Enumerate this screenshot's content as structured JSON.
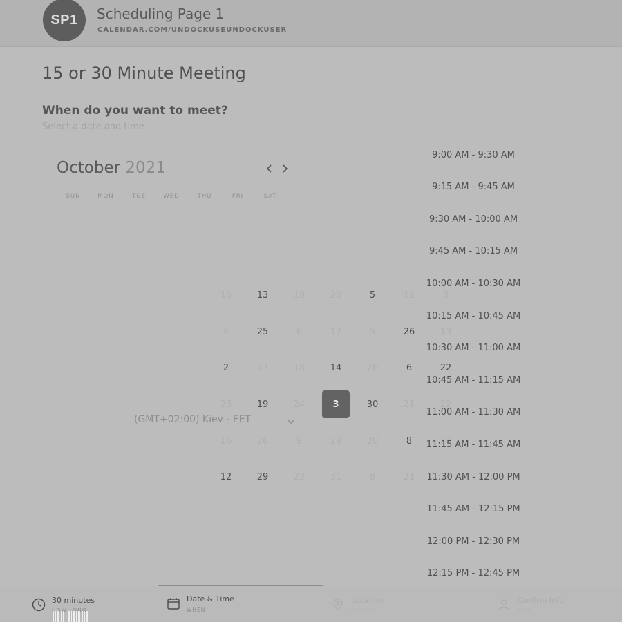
{
  "header": {
    "avatar_initials": "SP1",
    "page_name": "Scheduling Page 1",
    "page_url": "CALENDAR.COM/UNDOCKUSEUNDOCKUSER"
  },
  "meeting": {
    "title": "15 or 30 Minute Meeting",
    "question": "When do you want to meet?",
    "subtitle": "Select a date and time"
  },
  "calendar": {
    "month": "October",
    "year": "2021",
    "prev_icon": "chevron-left-icon",
    "next_icon": "chevron-right-icon",
    "weekdays": [
      "SUN",
      "MON",
      "TUE",
      "WED",
      "THU",
      "FRI",
      "SAT"
    ],
    "selected_day": "3",
    "days": [
      {
        "label": "16",
        "state": "faded"
      },
      {
        "label": "13",
        "state": "available"
      },
      {
        "label": "19",
        "state": "faded"
      },
      {
        "label": "20",
        "state": "faded"
      },
      {
        "label": "5",
        "state": "available"
      },
      {
        "label": "12",
        "state": "faded"
      },
      {
        "label": "8",
        "state": "faded"
      },
      {
        "label": "4",
        "state": "faded"
      },
      {
        "label": "25",
        "state": "available"
      },
      {
        "label": "6",
        "state": "faded"
      },
      {
        "label": "17",
        "state": "faded"
      },
      {
        "label": "5",
        "state": "faded"
      },
      {
        "label": "26",
        "state": "available"
      },
      {
        "label": "13",
        "state": "faded"
      },
      {
        "label": "2",
        "state": "available"
      },
      {
        "label": "27",
        "state": "faded"
      },
      {
        "label": "18",
        "state": "faded"
      },
      {
        "label": "14",
        "state": "available"
      },
      {
        "label": "26",
        "state": "faded"
      },
      {
        "label": "6",
        "state": "available"
      },
      {
        "label": "22",
        "state": "available"
      },
      {
        "label": "23",
        "state": "faded"
      },
      {
        "label": "19",
        "state": "available"
      },
      {
        "label": "24",
        "state": "faded"
      },
      {
        "label": "3",
        "state": "selected"
      },
      {
        "label": "30",
        "state": "available"
      },
      {
        "label": "21",
        "state": "faded"
      },
      {
        "label": "22",
        "state": "faded"
      },
      {
        "label": "16",
        "state": "faded"
      },
      {
        "label": "26",
        "state": "faded"
      },
      {
        "label": "9",
        "state": "faded"
      },
      {
        "label": "29",
        "state": "faded"
      },
      {
        "label": "20",
        "state": "faded"
      },
      {
        "label": "8",
        "state": "available"
      },
      {
        "label": "27",
        "state": "faded"
      },
      {
        "label": "12",
        "state": "available"
      },
      {
        "label": "29",
        "state": "available"
      },
      {
        "label": "23",
        "state": "faded"
      },
      {
        "label": "31",
        "state": "faded"
      },
      {
        "label": "8",
        "state": "faded"
      },
      {
        "label": "21",
        "state": "faded"
      },
      {
        "label": "22",
        "state": "faded"
      }
    ]
  },
  "timezone": {
    "label": "(GMT+02:00) Kiev - EET",
    "icon": "chevron-down-icon"
  },
  "time_slots": [
    "9:00 AM - 9:30 AM",
    "9:15 AM - 9:45 AM",
    "9:30 AM - 10:00 AM",
    "9:45 AM - 10:15 AM",
    "10:00 AM - 10:30 AM",
    "10:15 AM - 10:45 AM",
    "10:30 AM - 11:00 AM",
    "10:45 AM - 11:15 AM",
    "11:00 AM - 11:30 AM",
    "11:15 AM - 11:45 AM",
    "11:30 AM - 12:00 PM",
    "11:45 AM - 12:15 PM",
    "12:00 PM - 12:30 PM",
    "12:15 PM - 12:45 PM"
  ],
  "steps": [
    {
      "label": "30 minutes",
      "sub": "HOW LONG",
      "icon": "clock-icon"
    },
    {
      "label": "Date & Time",
      "sub": "WHEN",
      "icon": "calendar-icon"
    },
    {
      "label": "Location",
      "sub": "WHERE",
      "icon": "location-pin-icon"
    },
    {
      "label": "Confirm Info",
      "sub": "WHO",
      "icon": "user-icon"
    }
  ],
  "colors": {
    "background": "#bcbcbc",
    "selected_day": "#636363",
    "active_step_bar": "#8e8e8e"
  }
}
